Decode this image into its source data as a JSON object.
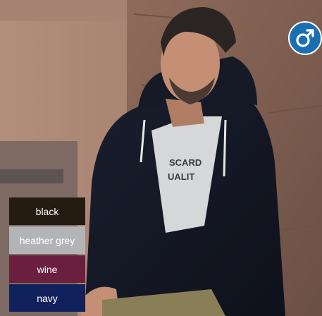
{
  "product": {
    "gender_icon": "male-symbol-icon",
    "badge_color": "#1a6fb0"
  },
  "colors": [
    {
      "label": "black",
      "hex": "#241c10",
      "text": "#ffffff"
    },
    {
      "label": "heather grey",
      "hex": "#b3b4b6",
      "text": "#ffffff"
    },
    {
      "label": "wine",
      "hex": "#6b1f3e",
      "text": "#ffffff"
    },
    {
      "label": "navy",
      "hex": "#10215c",
      "text": "#ffffff"
    }
  ]
}
